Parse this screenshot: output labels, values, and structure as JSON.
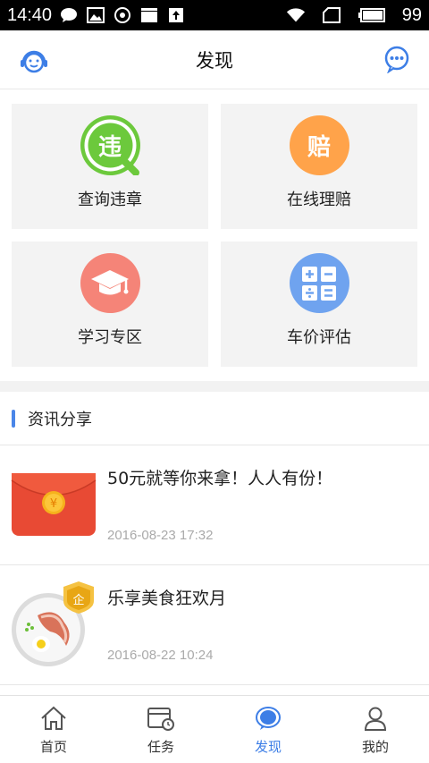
{
  "status_bar": {
    "time": "14:40",
    "battery": "99",
    "icons": [
      "chat-bubble-icon",
      "image-icon",
      "sync-icon",
      "clapper-icon",
      "upload-icon",
      "wifi-icon",
      "sim-icon",
      "battery-icon"
    ]
  },
  "header": {
    "title": "发现",
    "left_icon": "customer-service-icon",
    "right_icon": "message-icon"
  },
  "features": [
    {
      "label": "查询违章",
      "icon": "violation-search-icon",
      "color": "#6cc93c",
      "glyph": "违"
    },
    {
      "label": "在线理赔",
      "icon": "claim-icon",
      "color": "#ffa34a",
      "glyph": "赔"
    },
    {
      "label": "学习专区",
      "icon": "graduation-cap-icon",
      "color": "#f58478",
      "glyph": ""
    },
    {
      "label": "车价评估",
      "icon": "calculator-icon",
      "color": "#6fa3ef",
      "glyph": ""
    }
  ],
  "section": {
    "title": "资讯分享",
    "accent": "#4a86e8"
  },
  "news": [
    {
      "title": "50元就等你来拿！人人有份！",
      "date": "2016-08-23 17:32",
      "thumb": "red-envelope-icon"
    },
    {
      "title": "乐享美食狂欢月",
      "date": "2016-08-22 10:24",
      "thumb": "food-plate-icon"
    }
  ],
  "tabs": [
    {
      "label": "首页",
      "icon": "home-icon",
      "active": false
    },
    {
      "label": "任务",
      "icon": "task-icon",
      "active": false
    },
    {
      "label": "发现",
      "icon": "discover-icon",
      "active": true
    },
    {
      "label": "我的",
      "icon": "profile-icon",
      "active": false
    }
  ],
  "colors": {
    "accent": "#3d7ee6",
    "tile_bg": "#f3f3f3"
  }
}
